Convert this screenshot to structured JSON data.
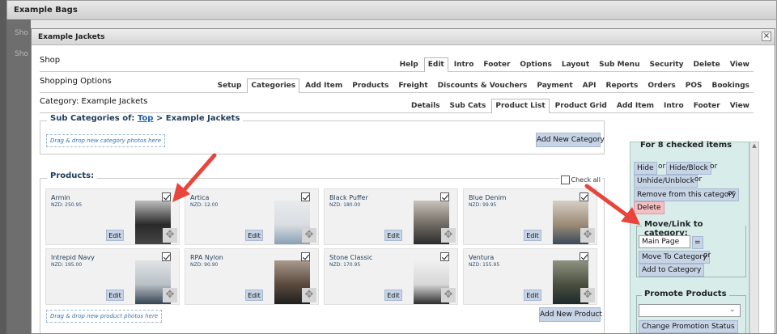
{
  "background_window": {
    "title": "Example Bags",
    "snippets": [
      "Sho",
      "Sho"
    ]
  },
  "dialog": {
    "title": "Example Jackets",
    "close_glyph": "×",
    "rows": [
      {
        "title": "Shop",
        "tabs": [
          "Help",
          "Edit",
          "Intro",
          "Footer",
          "Options",
          "Layout",
          "Sub Menu",
          "Security",
          "Delete",
          "View"
        ],
        "active": 1
      },
      {
        "title": "Shopping Options",
        "tabs": [
          "Setup",
          "Categories",
          "Add Item",
          "Products",
          "Freight",
          "Discounts & Vouchers",
          "Payment",
          "API",
          "Reports",
          "Orders",
          "POS",
          "Bookings"
        ],
        "active": 1
      },
      {
        "title": "Category: Example Jackets",
        "tabs": [
          "Details",
          "Sub Cats",
          "Product List",
          "Product Grid",
          "Add Item",
          "Intro",
          "Footer",
          "View"
        ],
        "active": 2
      }
    ]
  },
  "subcategories": {
    "legend_prefix": "Sub Categories of:",
    "legend_link": "Top",
    "legend_suffix": "> Example Jackets",
    "dropzone": "Drag & drop new category photos here",
    "add_button": "Add New Category"
  },
  "products": {
    "legend": "Products:",
    "check_all": "Check all",
    "dropzone": "Drag & drop new product photos here",
    "add_button": "Add New Product",
    "edit_label": "Edit",
    "move_glyph": "✥",
    "items": [
      {
        "name": "Armin",
        "price": "NZD: 250.95",
        "checked": true
      },
      {
        "name": "Artica",
        "price": "NZD: 12.00",
        "checked": true
      },
      {
        "name": "Black Puffer",
        "price": "NZD: 180.00",
        "checked": true
      },
      {
        "name": "Blue Denim",
        "price": "NZD: 99.95",
        "checked": true
      },
      {
        "name": "Intrepid Navy",
        "price": "NZD: 195.00",
        "checked": true
      },
      {
        "name": "RPA Nylon",
        "price": "NZD: 90.90",
        "checked": true
      },
      {
        "name": "Stone Classic",
        "price": "NZD: 170.95",
        "checked": true
      },
      {
        "name": "Ventura",
        "price": "NZD: 155.95",
        "checked": true
      }
    ]
  },
  "side_panel": {
    "heading": "For 8 checked items",
    "hide": "Hide",
    "hide_block": "Hide/Block",
    "unhide": "Unhide/Unblock",
    "remove": "Remove from this category",
    "delete": "Delete",
    "or": "or",
    "move_legend": "Move/Link to category:",
    "category_value": "Main Page",
    "equals": "=",
    "move_button": "Move To Category",
    "add_button": "Add to Category",
    "promote_legend": "Promote Products",
    "promotion_value": "",
    "promotion_button": "Change Promotion Status"
  },
  "colors": {
    "arrow": "#e8453c",
    "button": "#c7d4e6",
    "panel": "#d8ece9",
    "delete_button": "#f4c0c4"
  }
}
